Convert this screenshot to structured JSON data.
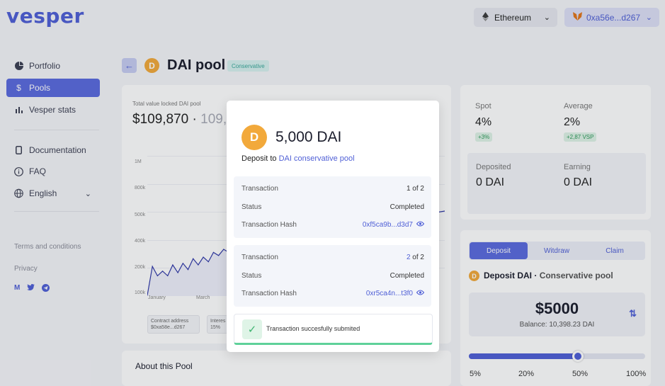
{
  "header": {
    "logo": "vesper",
    "network": "Ethereum",
    "wallet": "0xa56e...d267"
  },
  "sidebar": {
    "items": [
      {
        "label": "Portfolio",
        "icon": "pie-chart-icon"
      },
      {
        "label": "Pools",
        "icon": "dollar-icon"
      },
      {
        "label": "Vesper stats",
        "icon": "bar-chart-icon"
      },
      {
        "label": "Documentation",
        "icon": "document-icon"
      },
      {
        "label": "FAQ",
        "icon": "info-icon"
      },
      {
        "label": "English",
        "icon": "globe-icon"
      }
    ],
    "terms": "Terms and conditions",
    "privacy": "Privacy",
    "social": [
      "M",
      "twitter-icon",
      "telegram-icon"
    ]
  },
  "page": {
    "title": "DAI pool",
    "badge": "Conservative"
  },
  "tvl": {
    "label": "Total value locked DAI pool",
    "value": "$109,870",
    "secondary": "109,"
  },
  "chart_data": {
    "type": "line",
    "yticks": [
      "1M",
      "800k",
      "500k",
      "400k",
      "200k",
      "100k"
    ],
    "xticks": [
      "January",
      "March"
    ],
    "ylim": [
      100000,
      1000000
    ],
    "series": [
      {
        "values": [
          105000,
          290000,
          230000,
          260000,
          230000,
          300000,
          250000,
          310000,
          270000,
          340000,
          300000,
          350000,
          320000,
          380000,
          360000,
          400000,
          380000
        ]
      }
    ]
  },
  "info": {
    "contract_label": "Contract address",
    "contract_value": "$0xa58e...d267",
    "interest_label": "Interes",
    "interest_value": "15%"
  },
  "about": "About this Pool",
  "stats": {
    "spot_label": "Spot",
    "spot_value": "4%",
    "spot_pill": "+3%",
    "average_label": "Average",
    "average_value": "2%",
    "average_pill": "+2,87 VSP",
    "deposited_label": "Deposited",
    "deposited_value": "0 DAI",
    "earning_label": "Earning",
    "earning_value": "0 DAI"
  },
  "deposit_panel": {
    "tabs": [
      "Deposit",
      "Witdraw",
      "Claim"
    ],
    "title_main": "Deposit DAI",
    "title_sep": " · ",
    "title_pool": "Conservative pool",
    "amount": "$5000",
    "balance": "Balance: 10,398.23 DAI",
    "slider_value": 0.62,
    "percent_labels": [
      "5%",
      "20%",
      "50%",
      "100%"
    ]
  },
  "modal": {
    "amount": "5,000 DAI",
    "deposit_prefix": "Deposit to ",
    "deposit_pool": "DAI conservative pool",
    "tx1": {
      "label_tx": "Transaction",
      "step": "1",
      "step_of": " of 2",
      "label_status": "Status",
      "status": "Completed",
      "label_hash": "Transaction Hash",
      "hash": "0xf5ca9b...d3d7"
    },
    "tx2": {
      "label_tx": "Transaction",
      "step": "2",
      "step_of": " of 2",
      "label_status": "Status",
      "status": "Completed",
      "label_hash": "Transaction Hash",
      "hash": "0xr5ca4n...t3f0"
    },
    "toast": "Transaction succesfully submited"
  },
  "colors": {
    "accent": "#4f5fd6",
    "dai": "#f2a93b",
    "success": "#5fd19a"
  }
}
